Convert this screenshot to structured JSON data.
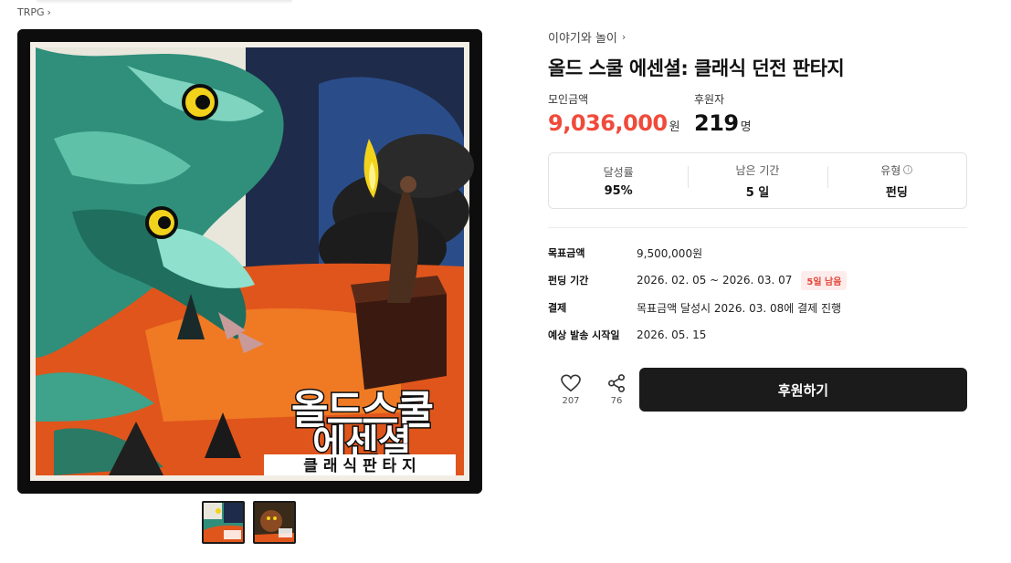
{
  "breadcrumb": {
    "label": "TRPG"
  },
  "category": {
    "label": "이야기와 놀이"
  },
  "project": {
    "title": "올드 스쿨 에센셜: 클래식 던전 판타지"
  },
  "funding": {
    "amount_label": "모인금액",
    "amount": "9,036,000",
    "amount_unit": "원",
    "backers_label": "후원자",
    "backers": "219",
    "backers_unit": "명"
  },
  "summary": [
    {
      "label": "달성률",
      "value": "95%"
    },
    {
      "label": "남은 기간",
      "value": "5 일"
    },
    {
      "label": "유형",
      "value": "펀딩",
      "icon": "info-icon"
    }
  ],
  "details": {
    "goal_label": "목표금액",
    "goal_value": "9,500,000원",
    "period_label": "펀딩 기간",
    "period_value": "2026. 02. 05 ~ 2026. 03. 07",
    "period_badge": "5일 남음",
    "payment_label": "결제",
    "payment_value": "목표금액 달성시 2026. 03. 08에 결제 진행",
    "ship_label": "예상 발송 시작일",
    "ship_value": "2026. 05. 15"
  },
  "actions": {
    "like_count": "207",
    "share_count": "76",
    "support_label": "후원하기"
  },
  "cover_text": {
    "line1": "올드스쿨",
    "line2": "에센셜",
    "line3": "클 래 식 판 타 지"
  },
  "colors": {
    "accent_red": "#f04a3a",
    "button_dark": "#1b1b1b",
    "badge_bg": "#fdeceb"
  }
}
